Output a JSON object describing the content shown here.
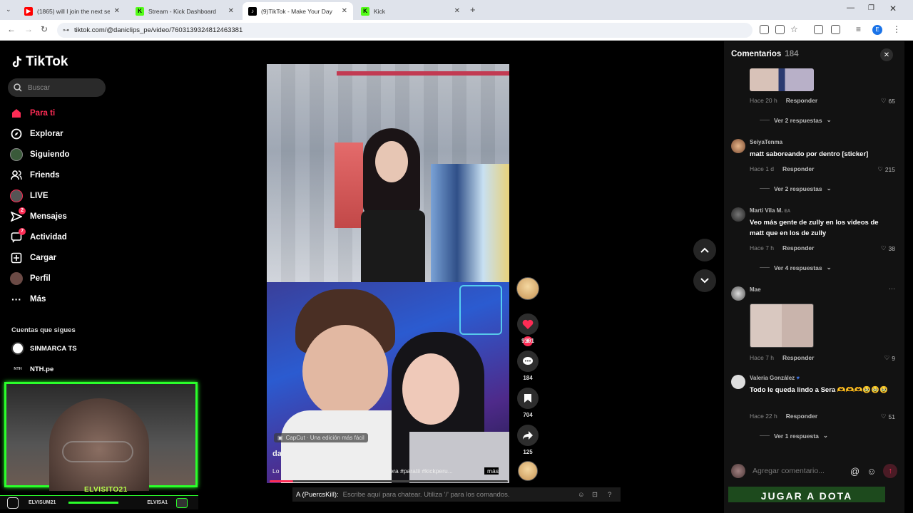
{
  "browser": {
    "tabs": [
      {
        "title": "(1865) will I join the next seaso",
        "icon": "youtube-icon",
        "active": false
      },
      {
        "title": "Stream - Kick Dashboard",
        "icon": "kick-icon",
        "active": false
      },
      {
        "title": "(9)TikTok - Make Your Day",
        "icon": "tiktok-icon",
        "active": true
      },
      {
        "title": "Kick",
        "icon": "kick-icon",
        "active": false
      }
    ],
    "url": "tiktok.com/@daniclips_pe/video/7603139324812463381",
    "profile_initial": "E"
  },
  "sidebar": {
    "logo": "TikTok",
    "search_placeholder": "Buscar",
    "nav": [
      {
        "label": "Para ti",
        "icon": "home-icon",
        "active": true
      },
      {
        "label": "Explorar",
        "icon": "compass-icon"
      },
      {
        "label": "Siguiendo",
        "icon": "following-icon"
      },
      {
        "label": "Friends",
        "icon": "friends-icon"
      },
      {
        "label": "LIVE",
        "icon": "live-icon"
      },
      {
        "label": "Mensajes",
        "icon": "messages-icon",
        "badge": "2"
      },
      {
        "label": "Actividad",
        "icon": "activity-icon",
        "badge": "7"
      },
      {
        "label": "Cargar",
        "icon": "upload-icon"
      },
      {
        "label": "Perfil",
        "icon": "profile-icon"
      },
      {
        "label": "Más",
        "icon": "more-icon"
      }
    ],
    "following_title": "Cuentas que sigues",
    "following": [
      {
        "name": "SINMARCA TS"
      },
      {
        "name": "NTH.pe",
        "avatar_text": "NTH"
      }
    ]
  },
  "video": {
    "capcut_label": "CapCut · Una edición más fácil",
    "author": "daniclips_pe",
    "caption": "Lo que se viene #mattkeelan #seraphine #sera #paratii #kickperu...",
    "more_label": "más",
    "progress": 0.1,
    "likes": "9101",
    "comments": "184",
    "saves": "704",
    "shares": "125"
  },
  "comments": {
    "title": "Comentarios",
    "count": "184",
    "items": [
      {
        "time": "Hace 20 h",
        "reply": "Responder",
        "likes": "65",
        "replies": "Ver 2 respuestas"
      },
      {
        "user": "SeiyaTenma",
        "text": "matt saboreando por dentro [sticker]",
        "time": "Hace 1 d",
        "reply": "Responder",
        "likes": "215",
        "replies": "Ver 2 respuestas"
      },
      {
        "user": "Marti Vila M.",
        "user_suffix": "EA",
        "text": "Veo más gente de zully en los videos de matt que en los de zully",
        "time": "Hace 7 h",
        "reply": "Responder",
        "likes": "38",
        "replies": "Ver 4 respuestas"
      },
      {
        "user": "Mae",
        "time": "Hace 7 h",
        "reply": "Responder",
        "likes": "9",
        "menu": "···"
      },
      {
        "user": "Valeria González",
        "text": "Todo le queda lindo a Sera 🫶🫶🫶🥹🥹🥹",
        "time": "Hace 22 h",
        "reply": "Responder",
        "likes": "51",
        "replies": "Ver 1 respuesta"
      }
    ],
    "input_placeholder": "Agregar comentario...",
    "at_symbol": "@"
  },
  "overlay": {
    "streamer_name": "ELVISITO21",
    "bottom_left": "ELVISUM21",
    "bottom_right": "ELVISA1",
    "banner": "JUGAR A DOTA",
    "chat_user": "A (PuercsKill):",
    "chat_placeholder": "Escribe aquí para chatear. Utiliza '/' para los comandos."
  },
  "colors": {
    "accent": "#fe2c55",
    "overlay_green": "#2bff2b"
  }
}
